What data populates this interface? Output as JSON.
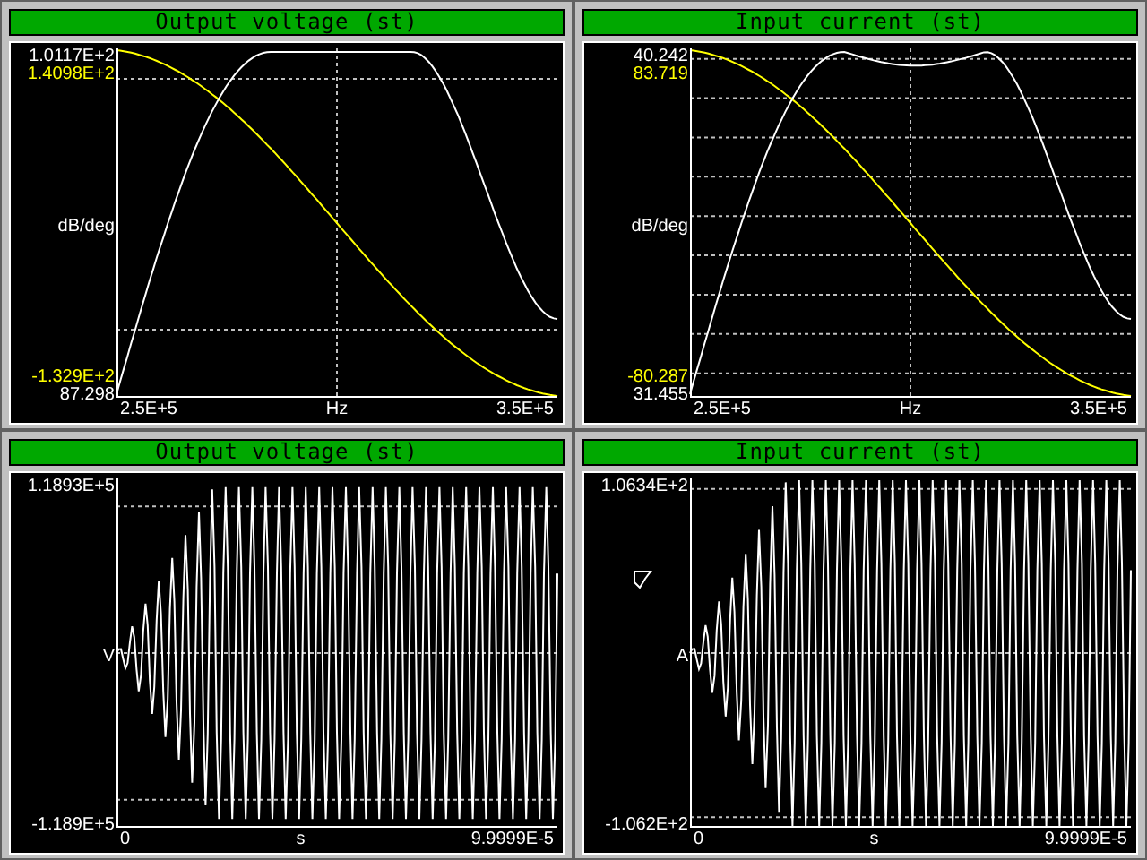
{
  "panels": [
    {
      "title": "Output voltage (st)",
      "kind": "bode",
      "top_labels": [
        {
          "text": "1.0117E+2",
          "color": "#ffffff"
        },
        {
          "text": "1.4098E+2",
          "color": "#ffff00"
        }
      ],
      "unit": "dB/deg",
      "bottom_labels": [
        {
          "text": "-1.329E+2",
          "color": "#ffff00"
        },
        {
          "text": "87.298",
          "color": "#ffffff"
        }
      ],
      "x_labels": [
        "2.5E+5",
        "Hz",
        "3.5E+5"
      ],
      "pointer": false
    },
    {
      "title": "Input current (st)",
      "kind": "bode",
      "top_labels": [
        {
          "text": "40.242",
          "color": "#ffffff"
        },
        {
          "text": "83.719",
          "color": "#ffff00"
        }
      ],
      "unit": "dB/deg",
      "bottom_labels": [
        {
          "text": "-80.287",
          "color": "#ffff00"
        },
        {
          "text": "31.455",
          "color": "#ffffff"
        }
      ],
      "x_labels": [
        "2.5E+5",
        "Hz",
        "3.5E+5"
      ],
      "pointer": false
    },
    {
      "title": "Output voltage (st)",
      "kind": "time",
      "top_labels": [
        {
          "text": "1.1893E+5",
          "color": "#ffffff"
        }
      ],
      "unit": "V",
      "bottom_labels": [
        {
          "text": "-1.189E+5",
          "color": "#ffffff"
        }
      ],
      "x_labels": [
        "0",
        "s",
        "9.9999E-5"
      ],
      "pointer": false
    },
    {
      "title": "Input current (st)",
      "kind": "time",
      "top_labels": [
        {
          "text": "1.0634E+2",
          "color": "#ffffff"
        }
      ],
      "unit": "A",
      "bottom_labels": [
        {
          "text": "-1.062E+2",
          "color": "#ffffff"
        }
      ],
      "x_labels": [
        "0",
        "s",
        "9.9999E-5"
      ],
      "pointer": true
    }
  ]
}
